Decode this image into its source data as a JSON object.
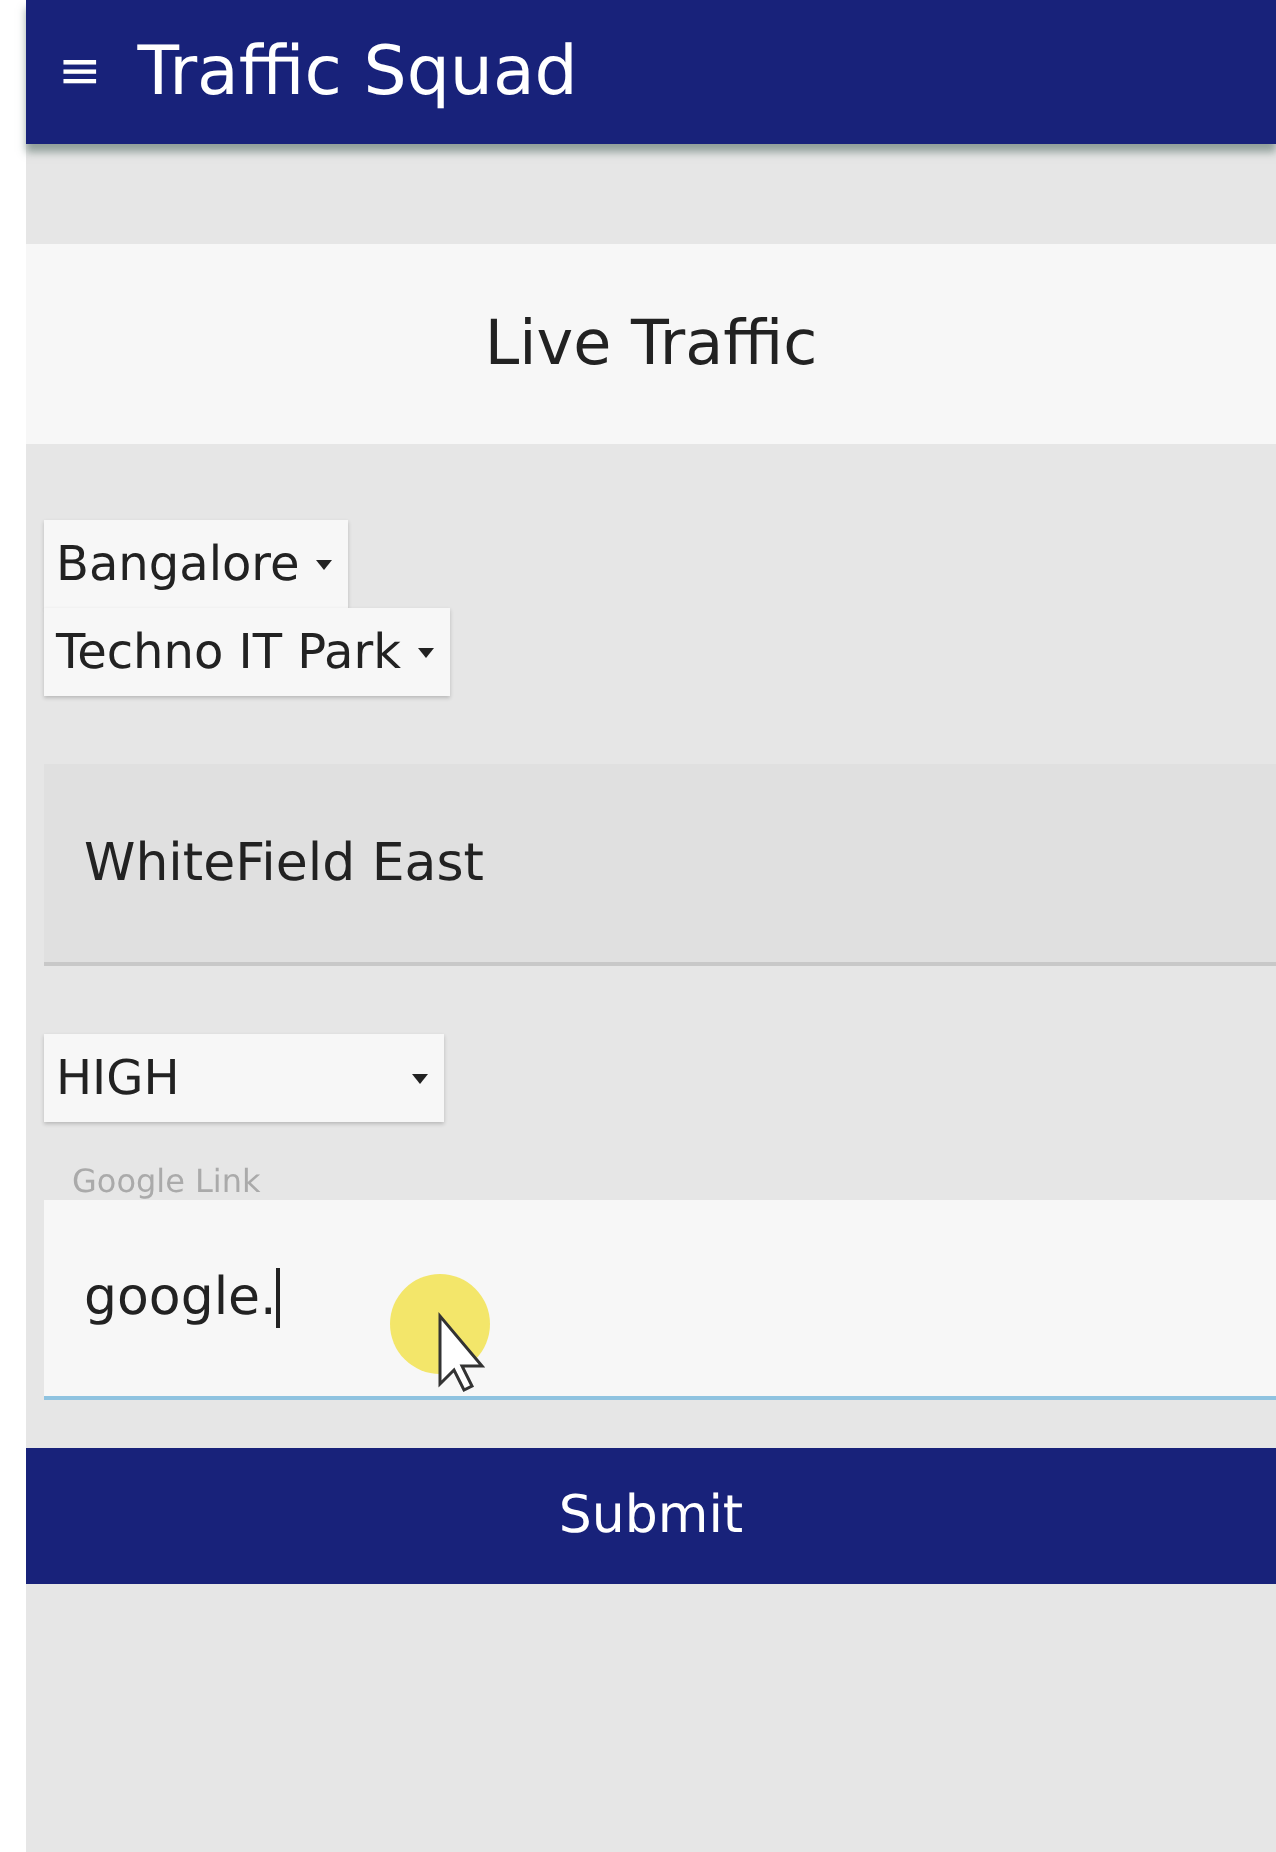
{
  "app_bar": {
    "menu_icon": "≡",
    "title": "Traffic Squad"
  },
  "page_title": "Live Traffic",
  "dropdowns": [
    {
      "value": "Bangalore"
    },
    {
      "value": "Techno IT Park"
    }
  ],
  "area_field": {
    "value": "WhiteField East"
  },
  "priority_select": {
    "value": "HIGH"
  },
  "link_field": {
    "label": "Google Link",
    "value": "google.",
    "focused": true
  },
  "submit_button": "Submit"
}
